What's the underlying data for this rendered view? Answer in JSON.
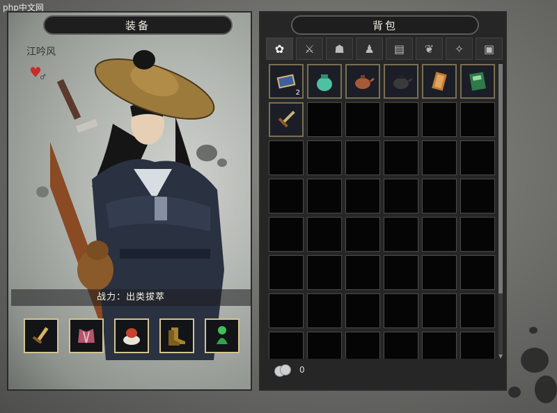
{
  "watermark": "php中文网",
  "equipment": {
    "title": "装备",
    "character_name": "江吟风",
    "combat_power": "战力：出类拔萃",
    "slots": [
      {
        "icon": "dagger-icon"
      },
      {
        "icon": "armor-icon"
      },
      {
        "icon": "food-icon"
      },
      {
        "icon": "boots-icon"
      },
      {
        "icon": "jade-figurine-icon"
      }
    ]
  },
  "bag": {
    "title": "背包",
    "tabs": [
      {
        "icon": "all-items-icon",
        "active": true
      },
      {
        "icon": "weapon-icon"
      },
      {
        "icon": "armor-tab-icon"
      },
      {
        "icon": "accessory-icon"
      },
      {
        "icon": "book-icon"
      },
      {
        "icon": "herb-icon"
      },
      {
        "icon": "hidden-weapon-icon"
      },
      {
        "icon": "misc-icon"
      }
    ],
    "items": [
      {
        "icon": "scroll-map-icon",
        "quantity": "2"
      },
      {
        "icon": "jade-pouch-icon",
        "quantity": ""
      },
      {
        "icon": "clay-teapot-icon",
        "quantity": ""
      },
      {
        "icon": "iron-teapot-icon",
        "quantity": ""
      },
      {
        "icon": "amber-token-icon",
        "quantity": ""
      },
      {
        "icon": "green-manual-icon",
        "quantity": ""
      },
      {
        "icon": "short-sword-icon",
        "quantity": ""
      }
    ],
    "money": "0"
  },
  "colors": {
    "gold_border": "#d4c490",
    "panel_dark": "#262626",
    "heart": "#c92a2a"
  }
}
